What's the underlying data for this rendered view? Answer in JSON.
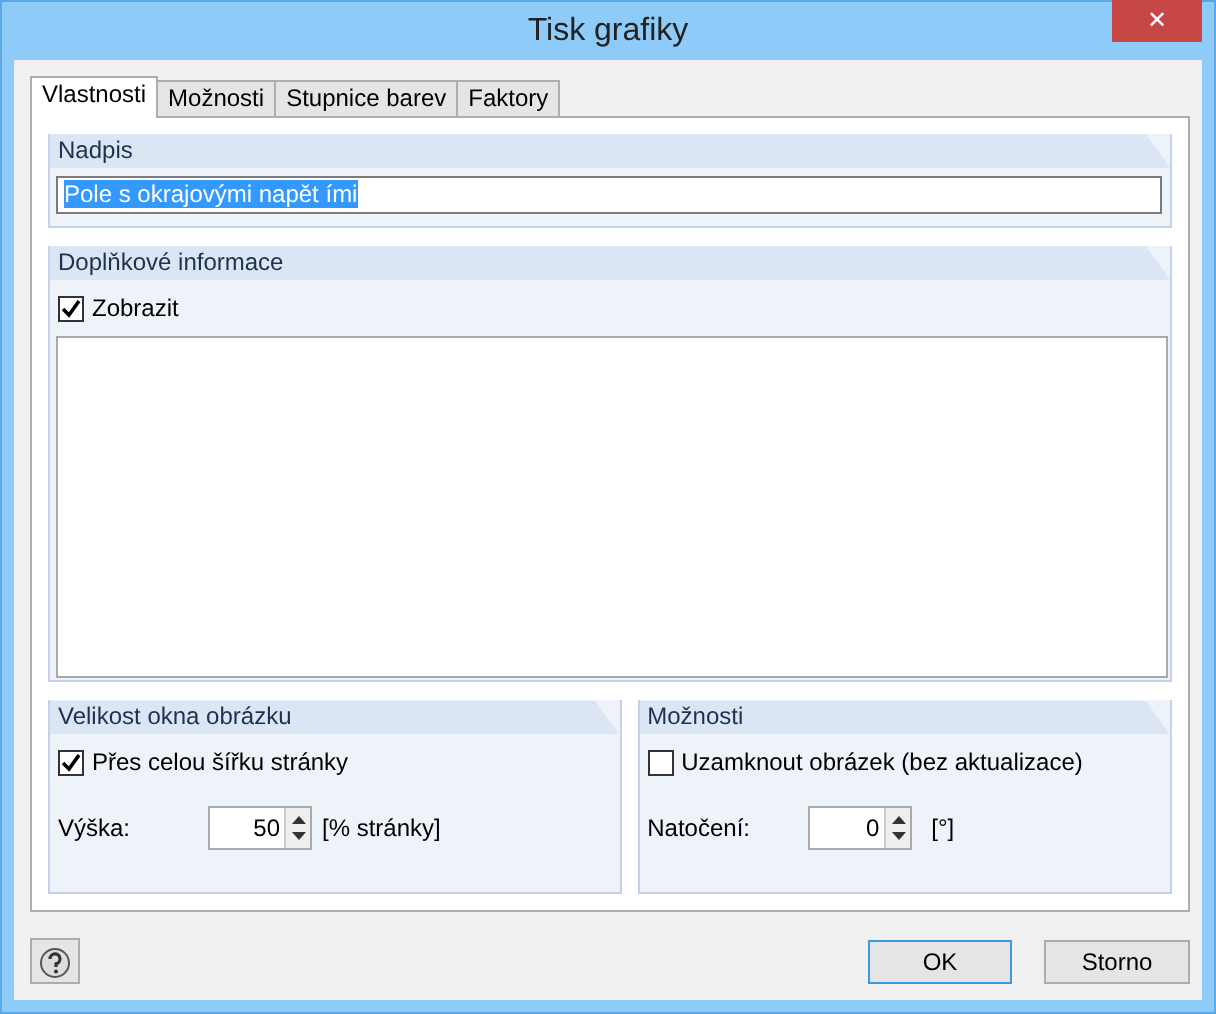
{
  "window": {
    "title": "Tisk grafiky",
    "close": "✕"
  },
  "tabs": [
    {
      "label": "Vlastnosti",
      "selected": true
    },
    {
      "label": "Možnosti",
      "selected": false
    },
    {
      "label": "Stupnice barev",
      "selected": false
    },
    {
      "label": "Faktory",
      "selected": false
    }
  ],
  "heading_group": {
    "title": "Nadpis",
    "value": "Pole s okrajovými napět ími",
    "value_selected": true
  },
  "info_group": {
    "title": "Doplňkové informace",
    "checkbox": {
      "label": "Zobrazit",
      "checked": true
    }
  },
  "size_group": {
    "title": "Velikost okna obrázku",
    "checkbox": {
      "label": "Přes celou šířku stránky",
      "checked": true
    },
    "field": {
      "label": "Výška:",
      "value": "50",
      "unit": "[% stránky]"
    }
  },
  "options_group": {
    "title": "Možnosti",
    "checkbox": {
      "label": "Uzamknout obrázek (bez aktualizace)",
      "checked": false
    },
    "field": {
      "label": "Natočení:",
      "value": "0",
      "unit": "[°]"
    }
  },
  "buttons": [
    {
      "label": "OK",
      "default": true
    },
    {
      "label": "Storno",
      "default": false
    }
  ]
}
